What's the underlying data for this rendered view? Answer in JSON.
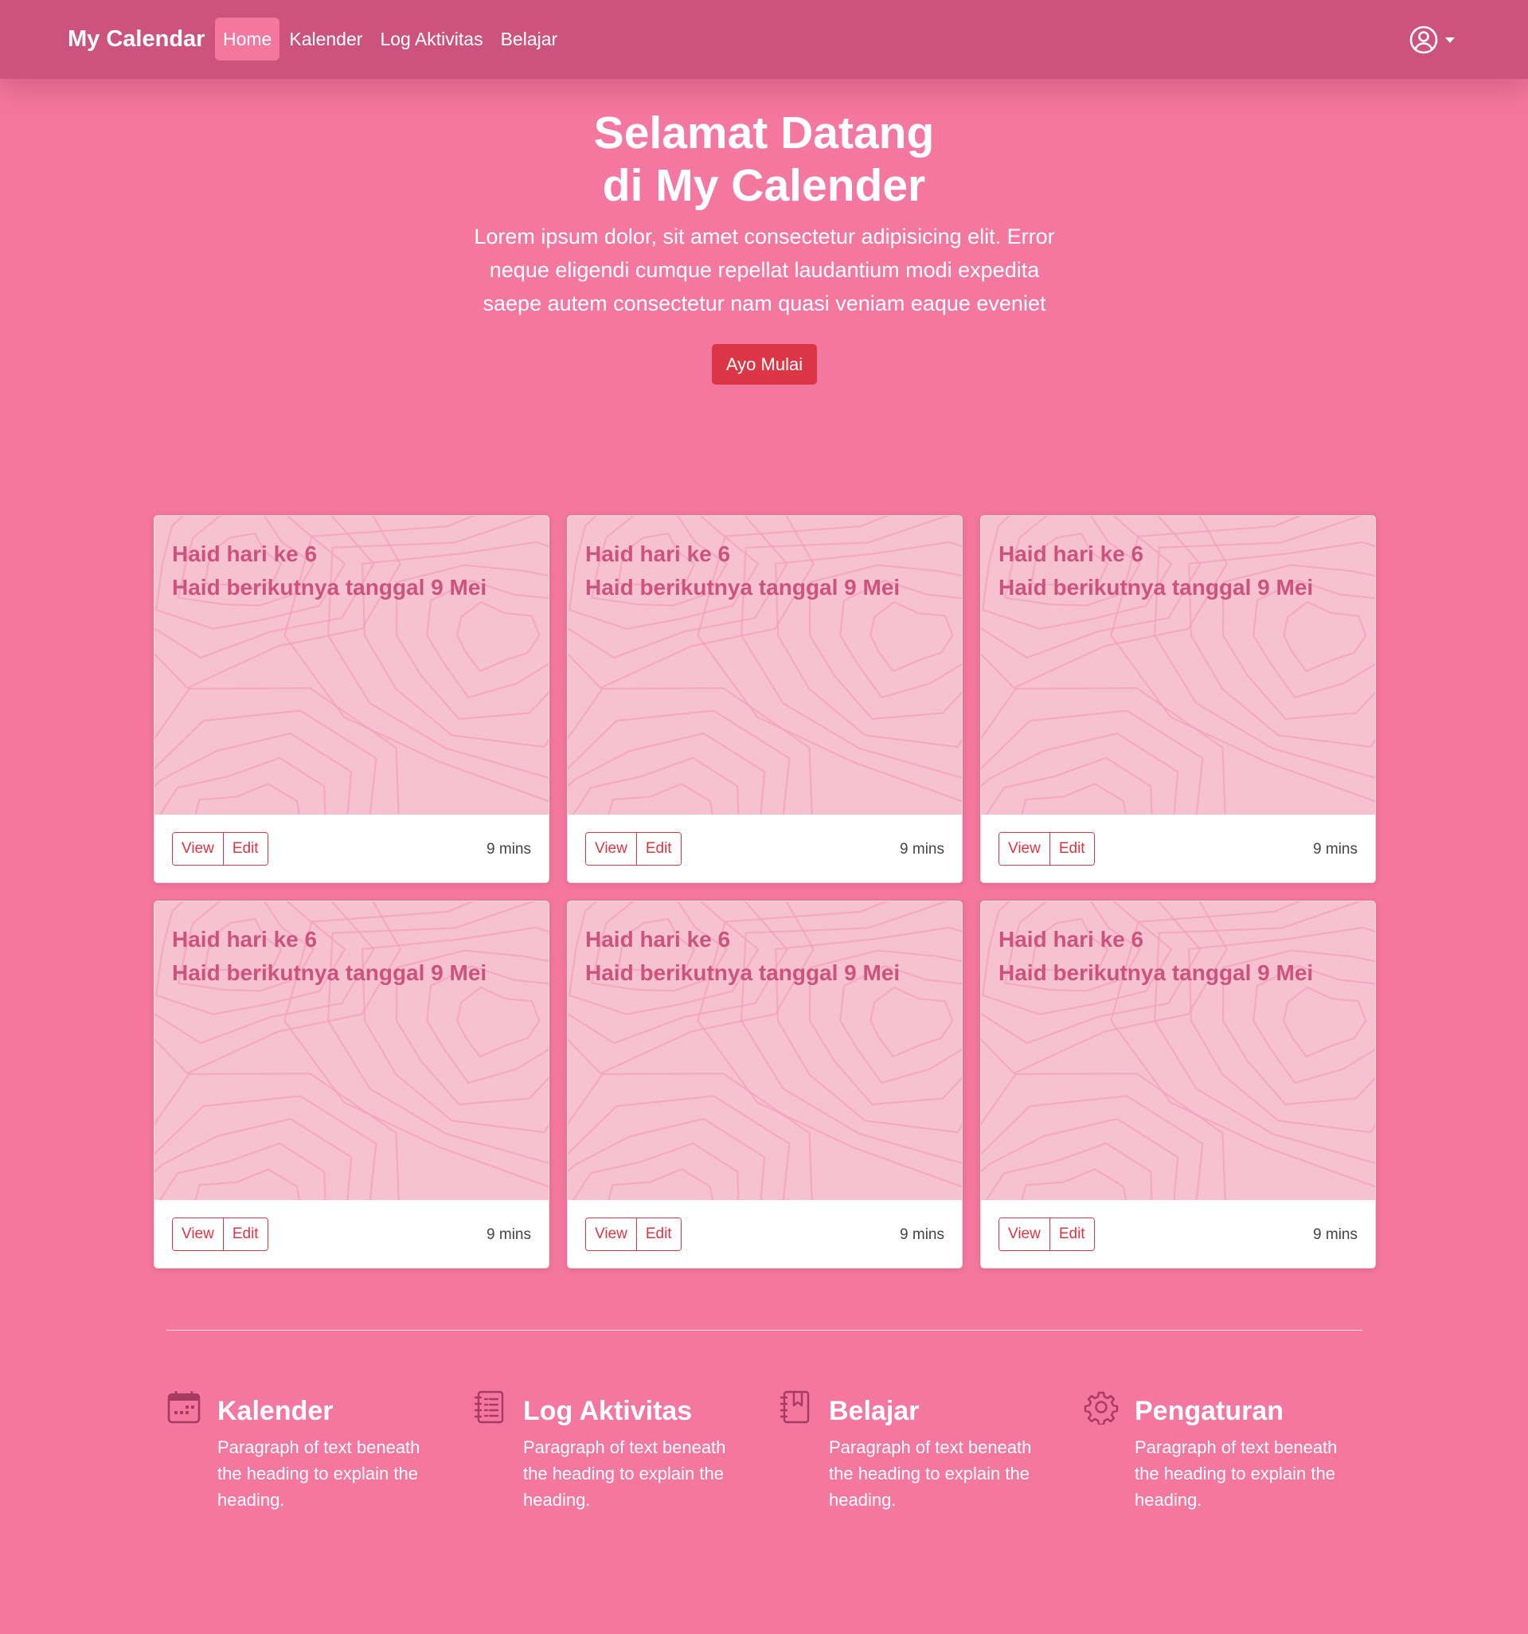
{
  "navbar": {
    "brand": "My Calendar",
    "links": [
      {
        "label": "Home"
      },
      {
        "label": "Kalender"
      },
      {
        "label": "Log Aktivitas"
      },
      {
        "label": "Belajar"
      }
    ],
    "user_icon": "user-circle-icon"
  },
  "hero": {
    "title_line1": "Selamat Datang",
    "title_line2": "di My Calender",
    "text": "Lorem ipsum dolor, sit amet consectetur adipisicing elit. Error neque eligendi cumque repellat laudantium modi expedita saepe autem consectetur nam quasi veniam eaque eveniet",
    "button": "Ayo Mulai"
  },
  "cards": [
    {
      "line1": "Haid hari ke 6",
      "line2": "Haid berikutnya tanggal 9 Mei",
      "view": "View",
      "edit": "Edit",
      "time": "9 mins"
    },
    {
      "line1": "Haid hari ke 6",
      "line2": "Haid berikutnya tanggal 9 Mei",
      "view": "View",
      "edit": "Edit",
      "time": "9 mins"
    },
    {
      "line1": "Haid hari ke 6",
      "line2": "Haid berikutnya tanggal 9 Mei",
      "view": "View",
      "edit": "Edit",
      "time": "9 mins"
    },
    {
      "line1": "Haid hari ke 6",
      "line2": "Haid berikutnya tanggal 9 Mei",
      "view": "View",
      "edit": "Edit",
      "time": "9 mins"
    },
    {
      "line1": "Haid hari ke 6",
      "line2": "Haid berikutnya tanggal 9 Mei",
      "view": "View",
      "edit": "Edit",
      "time": "9 mins"
    },
    {
      "line1": "Haid hari ke 6",
      "line2": "Haid berikutnya tanggal 9 Mei",
      "view": "View",
      "edit": "Edit",
      "time": "9 mins"
    }
  ],
  "features": [
    {
      "icon": "calendar-icon",
      "title": "Kalender",
      "text": "Paragraph of text beneath the heading to explain the heading."
    },
    {
      "icon": "journal-list-icon",
      "title": "Log Aktivitas",
      "text": "Paragraph of text beneath the heading to explain the heading."
    },
    {
      "icon": "journal-bookmark-icon",
      "title": "Belajar",
      "text": "Paragraph of text beneath the heading to explain the heading."
    },
    {
      "icon": "gear-icon",
      "title": "Pengaturan",
      "text": "Paragraph of text beneath the heading to explain the heading."
    }
  ],
  "colors": {
    "background": "#f3779e",
    "navbar": "#cc547c",
    "card_image": "#f6c2d2",
    "card_title": "#cc547c",
    "accent_button": "#dc3545",
    "icon": "#a83a62"
  }
}
